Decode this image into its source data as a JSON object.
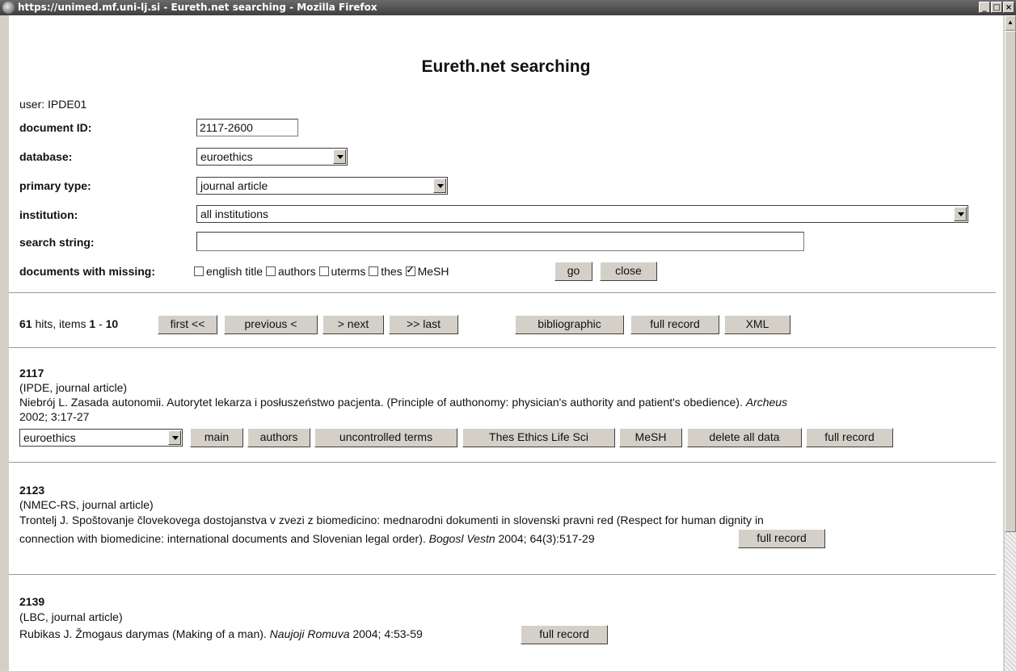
{
  "window": {
    "title": "https://unimed.mf.uni-lj.si - Eureth.net searching - Mozilla Firefox",
    "minimize": "_",
    "maximize": "□",
    "close": "×"
  },
  "page": {
    "heading": "Eureth.net searching",
    "user": "user: IPDE01"
  },
  "form": {
    "document_id_label": "document ID:",
    "document_id_value": "2117-2600",
    "database_label": "database:",
    "database_value": "euroethics",
    "primary_type_label": "primary type:",
    "primary_type_value": "journal article",
    "institution_label": "institution:",
    "institution_value": "all institutions",
    "search_label": "search string:",
    "search_value": "",
    "missing_label": "documents with missing:",
    "missing_options": [
      {
        "label": "english title",
        "checked": false
      },
      {
        "label": "authors",
        "checked": false
      },
      {
        "label": "uterms",
        "checked": false
      },
      {
        "label": "thes",
        "checked": false
      },
      {
        "label": "MeSH",
        "checked": true
      }
    ],
    "go_button": "go",
    "close_button": "close"
  },
  "results": {
    "hits": "61",
    "hits_text": " hits, items ",
    "range_start": "1",
    "range_sep": " - ",
    "range_end": "10",
    "first": "first <<",
    "previous": "previous <",
    "next": "> next",
    "last": ">> last",
    "bibliographic": "bibliographic",
    "full_record": "full record",
    "xml": "XML"
  },
  "records": [
    {
      "id": "2117",
      "source": "(IPDE, journal article)",
      "text": "Niebrój L. Zasada autonomii. Autorytet lekarza i posłuszeństwo pacjenta. (Principle of authonomy: physician's authority and patient's obedience). ",
      "journal": "Archeus",
      "citation_line2": "2002; 3:17-27",
      "db_select": "euroethics",
      "buttons": [
        "main",
        "authors",
        "uncontrolled terms",
        "Thes Ethics Life Sci",
        "MeSH",
        "delete all data",
        "full record"
      ]
    },
    {
      "id": "2123",
      "source": "(NMEC-RS, journal article)",
      "line1": "Trontelj J. Spoštovanje človekovega dostojanstva v zvezi z biomedicino: mednarodni dokumenti in slovenski pravni red (Respect for human dignity in",
      "line2": "connection with biomedicine: international documents and Slovenian legal order). ",
      "journal": "Bogosl Vestn",
      "citation": " 2004; 64(3):517-29",
      "button": "full record"
    },
    {
      "id": "2139",
      "source": "(LBC, journal article)",
      "text": "Rubikas J. Žmogaus darymas (Making of a man). ",
      "journal": "Naujoji Romuva",
      "citation": " 2004; 4:53-59",
      "button": "full record"
    }
  ]
}
